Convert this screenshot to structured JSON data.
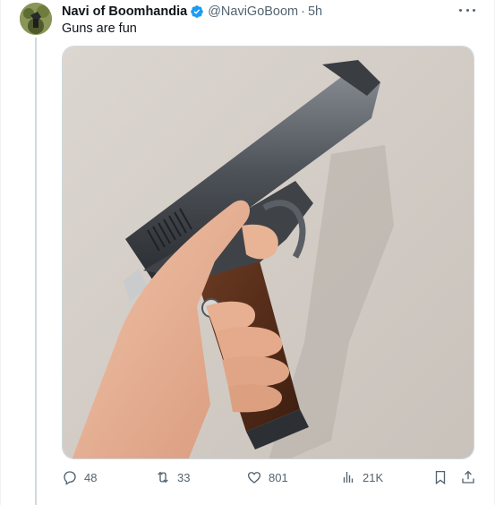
{
  "tweet": {
    "author_name": "Navi of Boomhandia",
    "handle": "@NaviGoBoom",
    "separator": "·",
    "time": "5h",
    "text": "Guns are fun",
    "media_description": "photo of a hand holding a pistol",
    "verified_icon": "verified-badge-icon",
    "more_icon": "more-options-icon"
  },
  "actions": {
    "reply_count": "48",
    "retweet_count": "33",
    "like_count": "801",
    "views_count": "21K"
  },
  "colors": {
    "verified": "#1d9bf0",
    "secondary_text": "#536471",
    "border": "#cfd9de"
  }
}
